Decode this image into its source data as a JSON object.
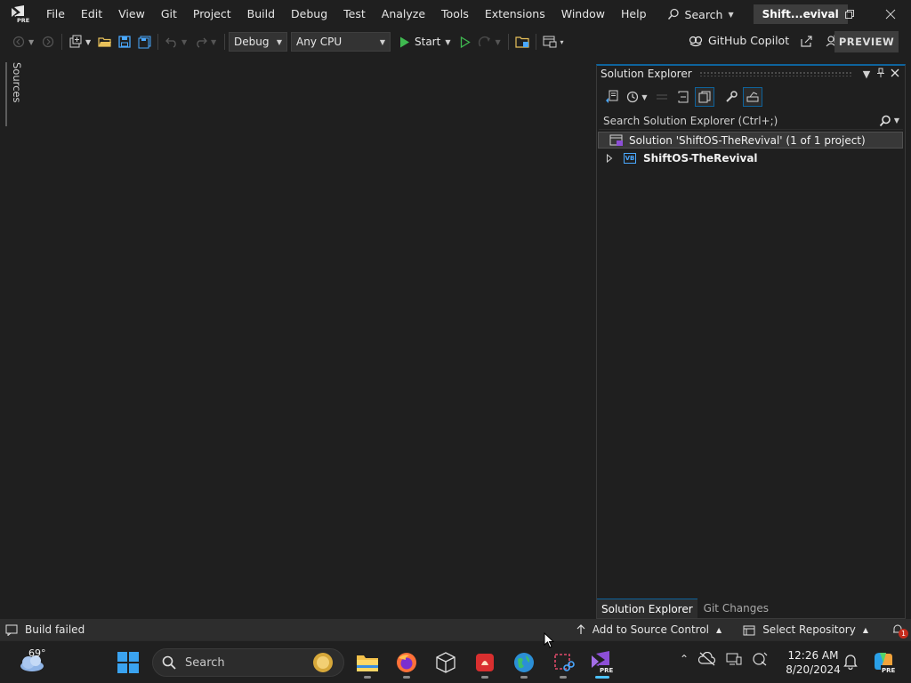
{
  "titlebar": {
    "menu": [
      "File",
      "Edit",
      "View",
      "Git",
      "Project",
      "Build",
      "Debug",
      "Test",
      "Analyze",
      "Tools",
      "Extensions",
      "Window",
      "Help"
    ],
    "search_label": "Search",
    "project_title": "Shift...evival",
    "logo_badge": "PRE"
  },
  "toolbar": {
    "config": "Debug",
    "platform": "Any CPU",
    "start_label": "Start",
    "copilot_label": "GitHub Copilot",
    "preview_label": "PREVIEW"
  },
  "left_strip": {
    "data_sources_label": "Data Sources"
  },
  "solution_explorer": {
    "title": "Solution Explorer",
    "search_placeholder": "Search Solution Explorer (Ctrl+;)",
    "solution_label": "Solution 'ShiftOS-TheRevival' (1 of 1 project)",
    "project_label": "ShiftOS-TheRevival",
    "project_badge": "VB",
    "tab_active": "Solution Explorer",
    "tab_inactive": "Git Changes"
  },
  "statusbar": {
    "status_text": "Build failed",
    "source_control": "Add to Source Control",
    "repository": "Select Repository",
    "notification_count": "1"
  },
  "taskbar": {
    "weather_temp": "69°",
    "search_placeholder": "Search",
    "time": "12:26 AM",
    "date": "8/20/2024"
  },
  "colors": {
    "accent_blue": "#0e639c",
    "status_bar": "#2d2d2d",
    "vs_purple": "#8d4fd7",
    "start_green": "#3fb950"
  }
}
